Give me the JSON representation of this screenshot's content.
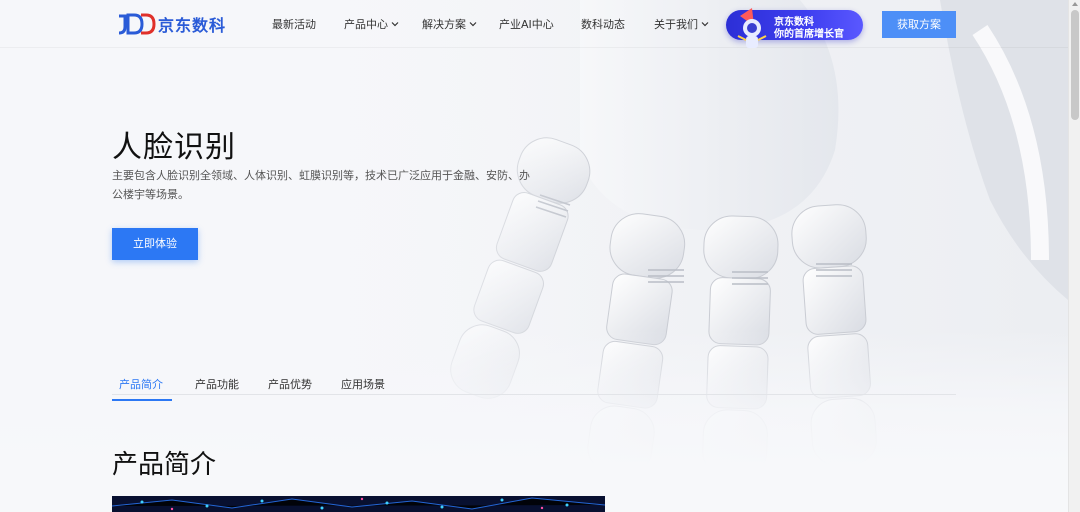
{
  "header": {
    "logo": {
      "mark": "JDD",
      "name": "京东数科"
    },
    "nav": [
      {
        "label": "最新活动",
        "dropdown": false
      },
      {
        "label": "产品中心",
        "dropdown": true
      },
      {
        "label": "解决方案",
        "dropdown": true
      },
      {
        "label": "产业AI中心",
        "dropdown": false
      },
      {
        "label": "数科动态",
        "dropdown": false
      },
      {
        "label": "关于我们",
        "dropdown": true
      }
    ],
    "promo": {
      "line1": "京东数科",
      "line2": "你的首席增长官"
    },
    "cta_label": "获取方案"
  },
  "hero": {
    "title": "人脸识别",
    "description": "主要包含人脸识别全领域、人体识别、虹膜识别等，技术已广泛应用于金融、安防、办公楼宇等场景。",
    "button_label": "立即体验"
  },
  "tabs": [
    {
      "label": "产品简介",
      "active": true
    },
    {
      "label": "产品功能",
      "active": false
    },
    {
      "label": "产品优势",
      "active": false
    },
    {
      "label": "应用场景",
      "active": false
    }
  ],
  "section": {
    "title": "产品简介"
  },
  "colors": {
    "accent": "#2c78f4",
    "brand": "#2a5bd7",
    "promo": "#3f3ff0"
  },
  "icons": {
    "chevron": "chevron-down-icon",
    "logo": "jdd-logo-icon"
  }
}
